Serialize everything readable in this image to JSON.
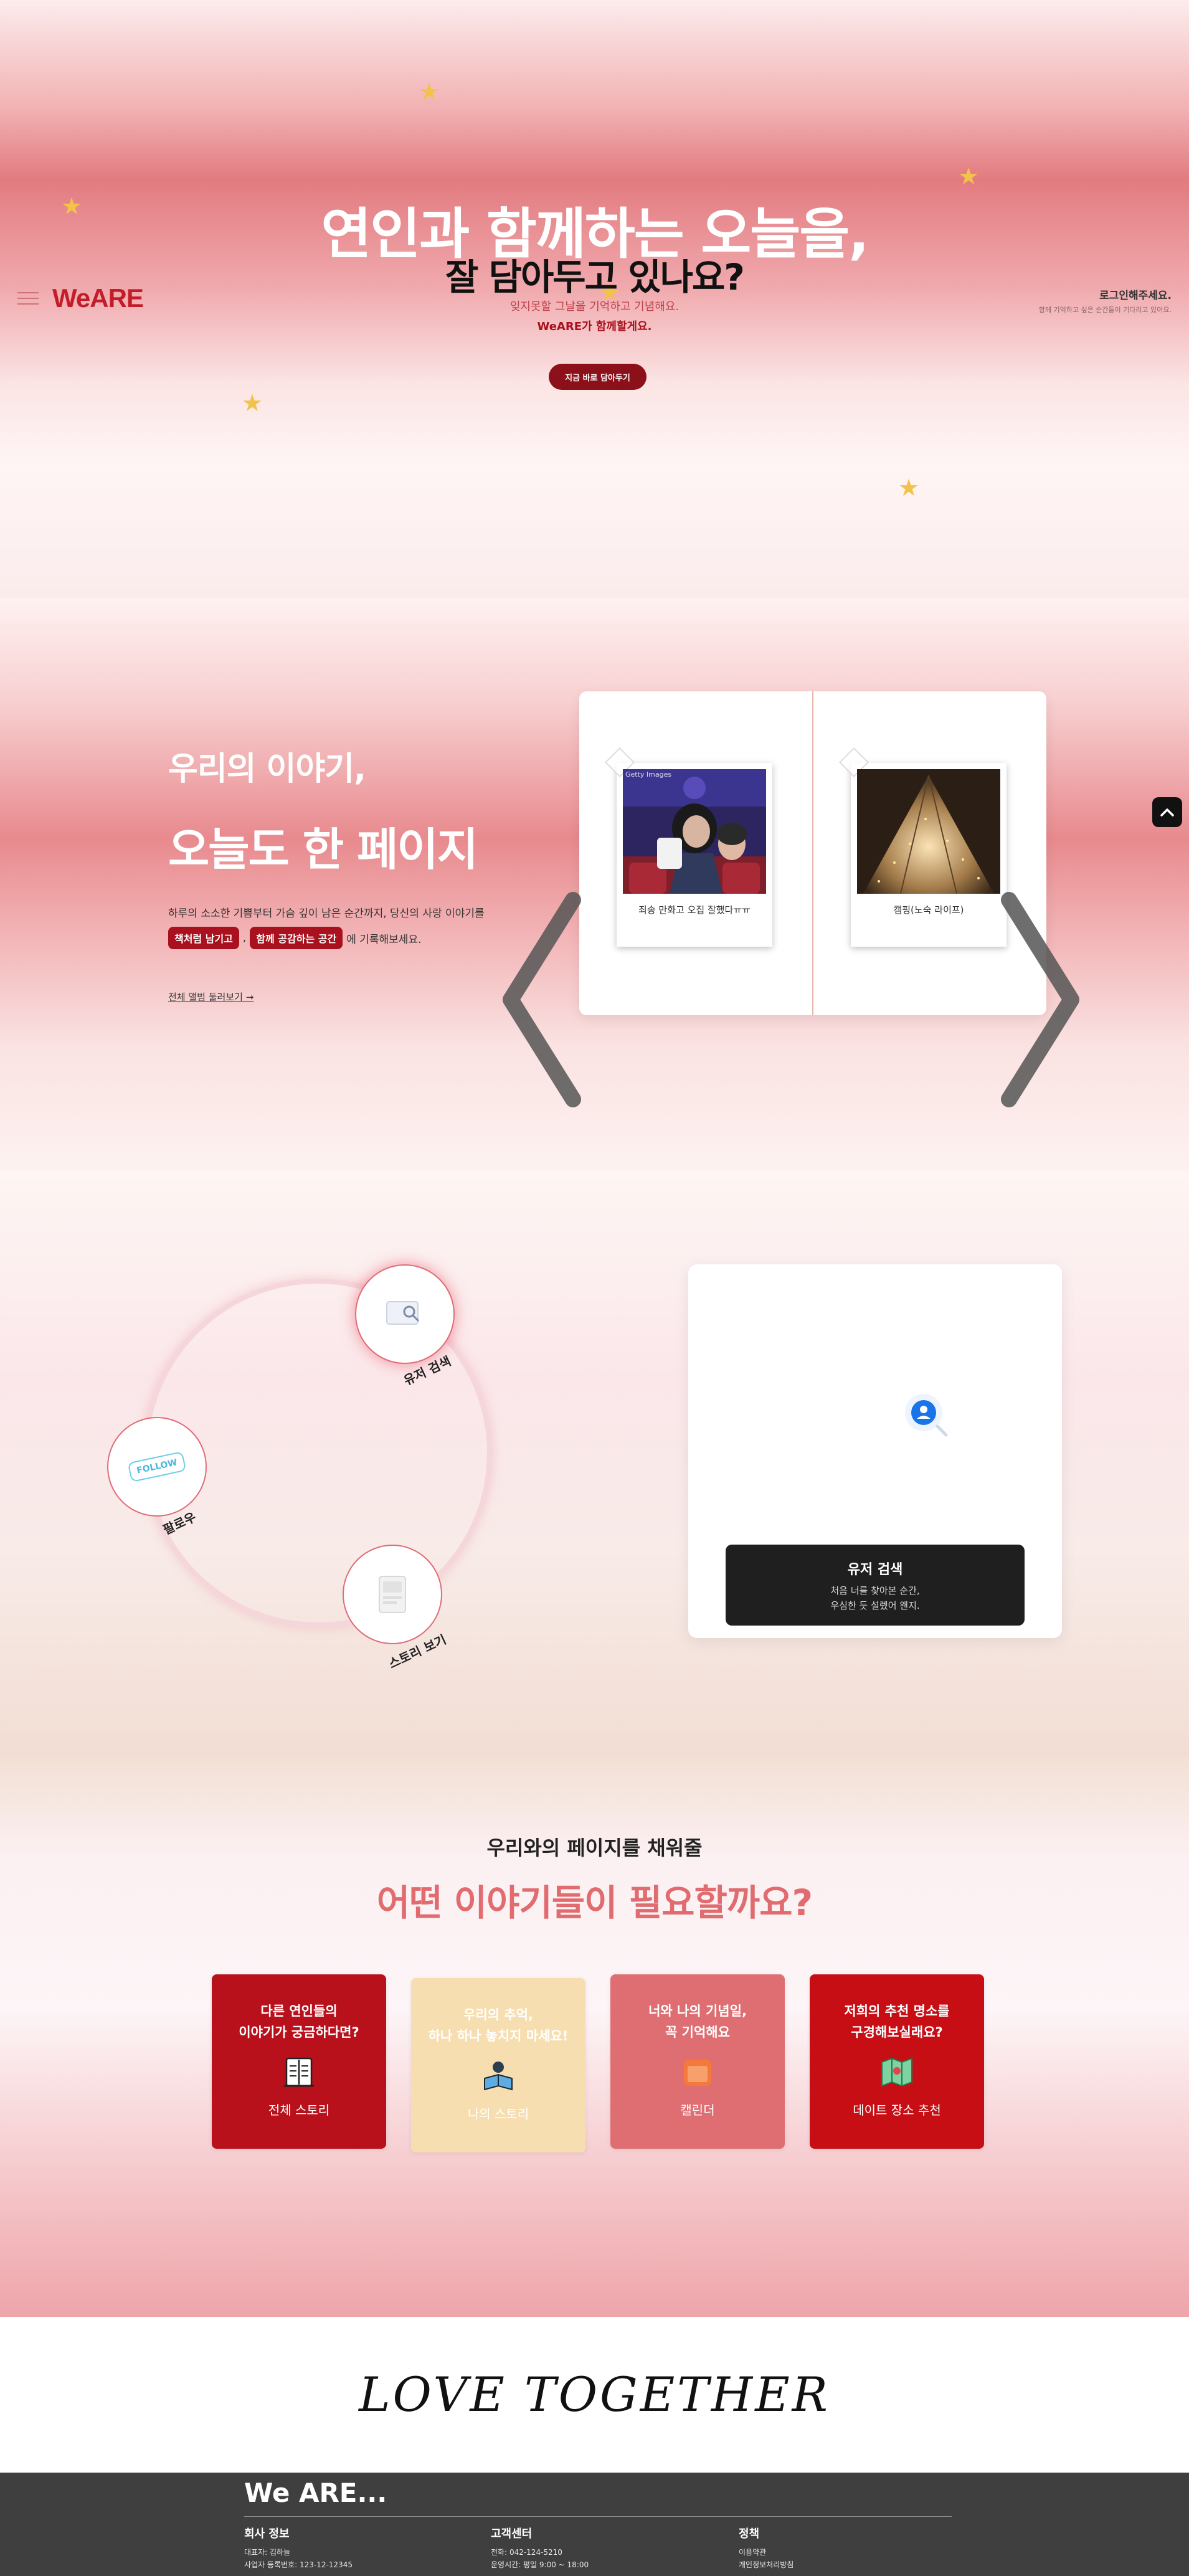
{
  "header": {
    "logo": "WeARE",
    "login_title": "로그인해주세요.",
    "login_desc": "함께 기억하고 싶은 순간들이 기다리고 있어요."
  },
  "hero": {
    "title_line1": "연인과 함께하는 오늘을,",
    "title_line2": "잘 담아두고 있나요?",
    "sub_line1": "잊지못할 그날을 기억하고 기념해요.",
    "sub_line2": "WeARE가 함께할게요.",
    "cta_label": "지금 바로 담아두기"
  },
  "story": {
    "title_line1": "우리의 이야기,",
    "title_line2": "오늘도 한 페이지",
    "para_line1": "하루의 소소한 기쁨부터 가슴 깊이 남은 순간까지, 당신의 사랑 이야기를",
    "tag1": "책처럼 남기고",
    "comma": ",",
    "tag2": "함께 공감하는 공간",
    "para_end": "에 기록해보세요.",
    "link": "전체 앨범 둘러보기 →",
    "photo1_caption": "죄송 만화고 오집 잘했다ㅠㅠ",
    "photo1_watermark": "Getty Images",
    "photo2_caption": "캠핑(노숙 라이프)"
  },
  "features": {
    "node1_label": "유저 검색",
    "node2_label": "팔로우",
    "node3_label": "스토리 보기",
    "follow_stamp": "FOLLOW",
    "panel_title": "유저 검색",
    "panel_desc1": "처음 너를 찾아본 순간,",
    "panel_desc2": "우심한 듯 설렜어 왠지."
  },
  "needs": {
    "subtitle": "우리와의 페이지를 채워줄",
    "title": "어떤 이야기들이 필요할까요?",
    "cards": [
      {
        "title1": "다른 연인들의",
        "title2": "이야기가 궁금하다면?",
        "label": "전체 스토리",
        "bg": "#b8111c",
        "color": "#ffffff"
      },
      {
        "title1": "우리의 추억,",
        "title2": "하나 하나 놓치지 마세요!",
        "label": "나의 스토리",
        "bg": "#f7deb0",
        "color": "#ffffff"
      },
      {
        "title1": "너와 나의 기념일,",
        "title2": "꼭 기억해요",
        "label": "캘린더",
        "bg": "#de6e72",
        "color": "#ffffff"
      },
      {
        "title1": "저희의 추천 명소를",
        "title2": "구경해보실래요?",
        "label": "데이트 장소 추천",
        "bg": "#c70e15",
        "color": "#ffffff"
      }
    ]
  },
  "love": {
    "text": "LOVE TOGETHER"
  },
  "footer": {
    "brand": "We ARE...",
    "col1_title": "회사 정보",
    "col1_line1": "대표자: 김하늘",
    "col1_line2": "사업자 등록번호: 123-12-12345",
    "col2_title": "고객센터",
    "col2_line1": "전화: 042-124-5210",
    "col2_line2": "운영시간: 평일 9:00 ~ 18:00",
    "col3_title": "정책",
    "col3_line1": "이용약관",
    "col3_line2": "개인정보처리방침"
  },
  "colors": {
    "brand_red": "#c21e2a",
    "dark_red": "#8c1019",
    "accent_pink": "#e06c70",
    "footer_bg": "#3f3f3f"
  },
  "icons": [
    "star-icon",
    "hamburger-icon",
    "chevron-left-icon",
    "chevron-right-icon",
    "chevron-up-icon",
    "search-icon",
    "user-icon",
    "book-icon",
    "calendar-icon",
    "map-icon"
  ]
}
